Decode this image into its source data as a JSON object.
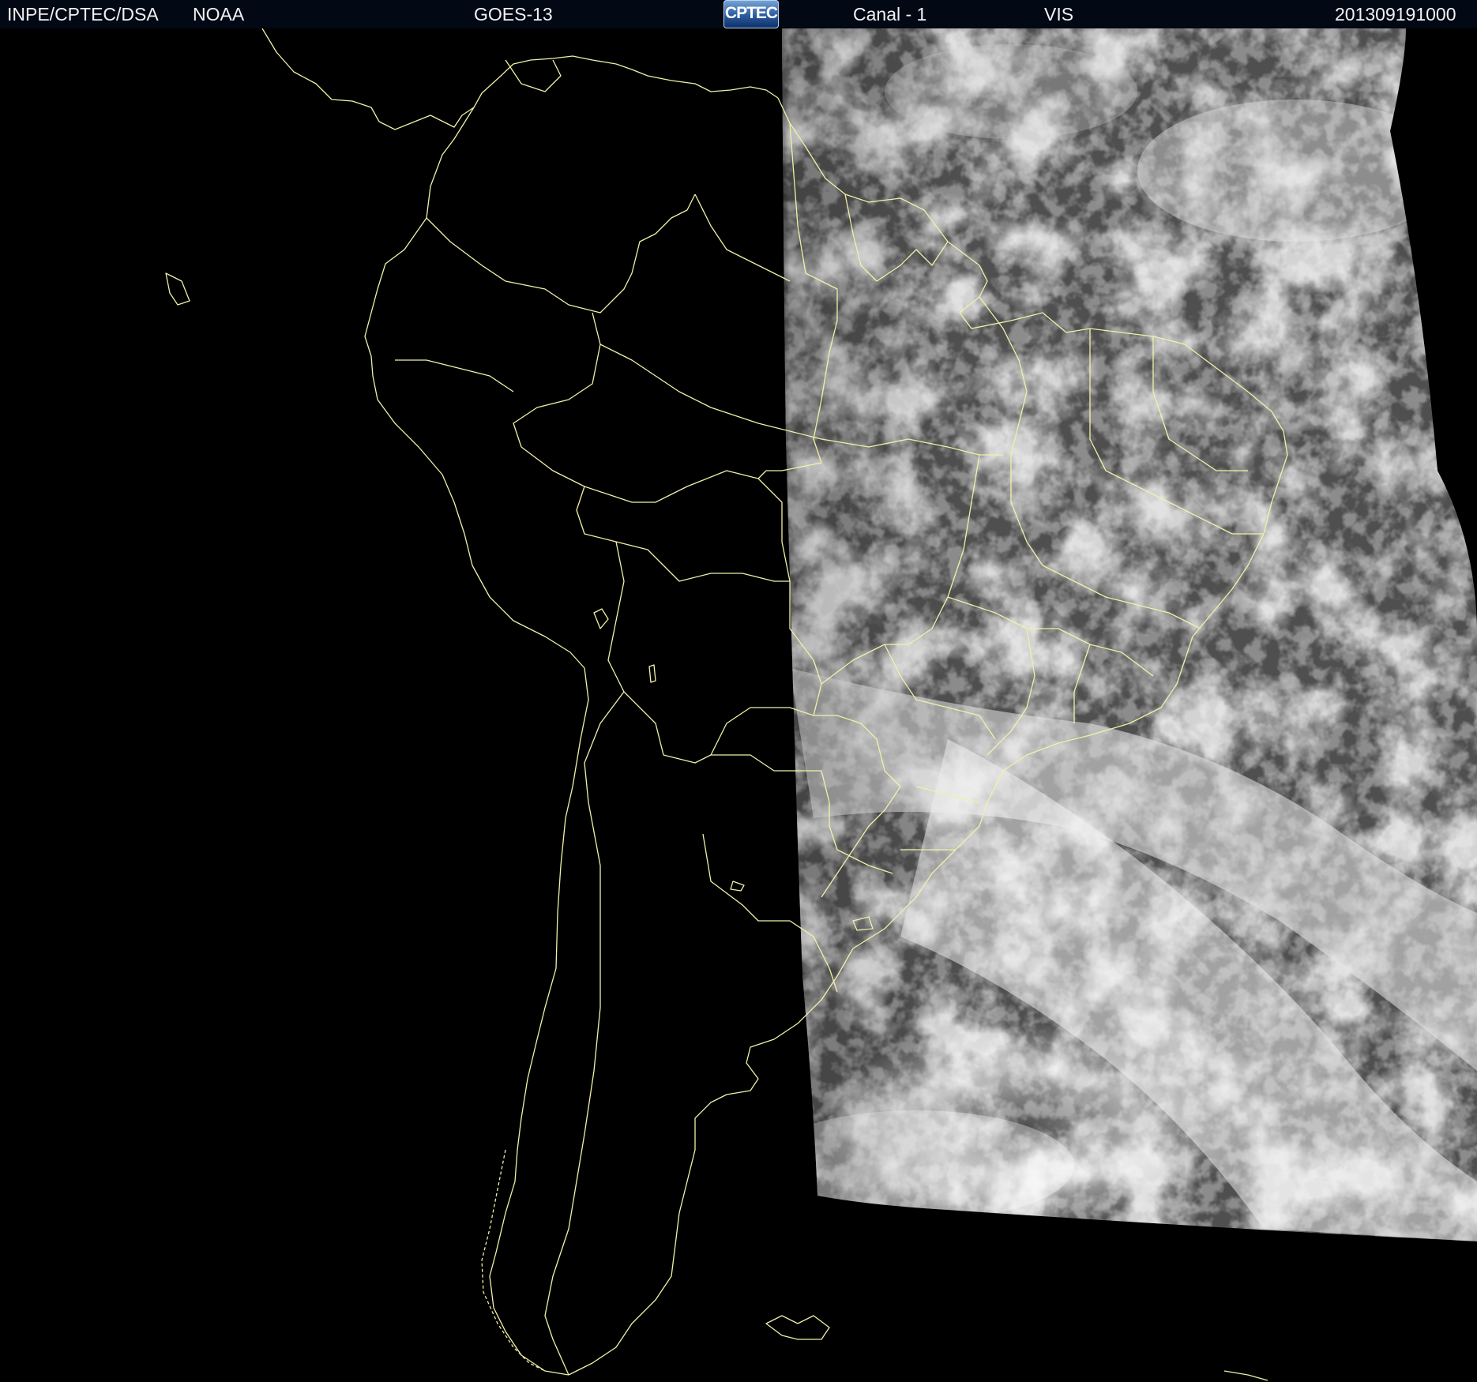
{
  "header": {
    "agency": "INPE/CPTEC/DSA",
    "source": "NOAA",
    "satellite": "GOES-13",
    "logo_text": "CPTEC",
    "channel": "Canal - 1",
    "band": "VIS",
    "timestamp": "201309191000"
  },
  "map": {
    "projection": "satellite visible imagery",
    "boundary_color": "#f1f1a8",
    "icons": [
      "coastline-overlay",
      "country-border-overlay",
      "state-border-overlay",
      "cloud-imagery"
    ]
  }
}
